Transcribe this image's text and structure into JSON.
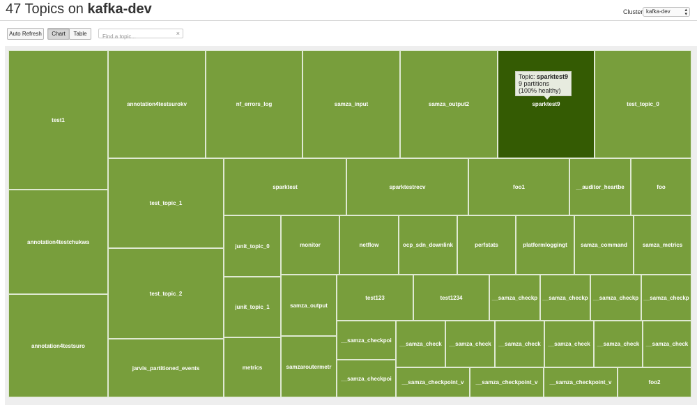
{
  "header": {
    "title_count": "47 Topics on",
    "title_cluster": "kafka-dev",
    "cluster_label": "Cluster:",
    "cluster_selected": "kafka-dev"
  },
  "toolbar": {
    "auto_refresh": "Auto Refresh",
    "chart": "Chart",
    "table": "Table",
    "search_placeholder": "Find a topic...",
    "clear_icon": "×"
  },
  "tooltip": {
    "prefix": "Topic:",
    "topic": "sparktest9",
    "partitions": "9 partitions",
    "health": "(100% healthy)"
  },
  "colors": {
    "cell": "#789e3c",
    "selected_cell": "#345b03"
  },
  "topics": [
    {
      "label": "test1"
    },
    {
      "label": "annotation4testchukwa"
    },
    {
      "label": "annotation4testsuro"
    },
    {
      "label": "annotation4testsurokv"
    },
    {
      "label": "nf_errors_log"
    },
    {
      "label": "samza_input"
    },
    {
      "label": "samza_output2"
    },
    {
      "label": "sparktest9"
    },
    {
      "label": "test_topic_0"
    },
    {
      "label": "test_topic_1"
    },
    {
      "label": "sparktest"
    },
    {
      "label": "sparktestrecv"
    },
    {
      "label": "foo1"
    },
    {
      "label": "__auditor_heartbe"
    },
    {
      "label": "foo"
    },
    {
      "label": "junit_topic_0"
    },
    {
      "label": "monitor"
    },
    {
      "label": "netflow"
    },
    {
      "label": "ocp_sdn_downlink"
    },
    {
      "label": "perfstats"
    },
    {
      "label": "platformloggingt"
    },
    {
      "label": "samza_command"
    },
    {
      "label": "samza_metrics"
    },
    {
      "label": "test_topic_2"
    },
    {
      "label": "junit_topic_1"
    },
    {
      "label": "samza_output"
    },
    {
      "label": "test123"
    },
    {
      "label": "test1234"
    },
    {
      "label": "__samza_checkp"
    },
    {
      "label": "__samza_checkp"
    },
    {
      "label": "__samza_checkp"
    },
    {
      "label": "__samza_checkp"
    },
    {
      "label": "__samza_checkpoi"
    },
    {
      "label": "__samza_check"
    },
    {
      "label": "__samza_check"
    },
    {
      "label": "__samza_check"
    },
    {
      "label": "__samza_check"
    },
    {
      "label": "__samza_check"
    },
    {
      "label": "__samza_check"
    },
    {
      "label": "jarvis_partitioned_events"
    },
    {
      "label": "metrics"
    },
    {
      "label": "samzaroutermetr"
    },
    {
      "label": "__samza_checkpoi"
    },
    {
      "label": "__samza_checkpoint_v"
    },
    {
      "label": "__samza_checkpoint_v"
    },
    {
      "label": "__samza_checkpoint_v"
    },
    {
      "label": "foo2"
    }
  ]
}
